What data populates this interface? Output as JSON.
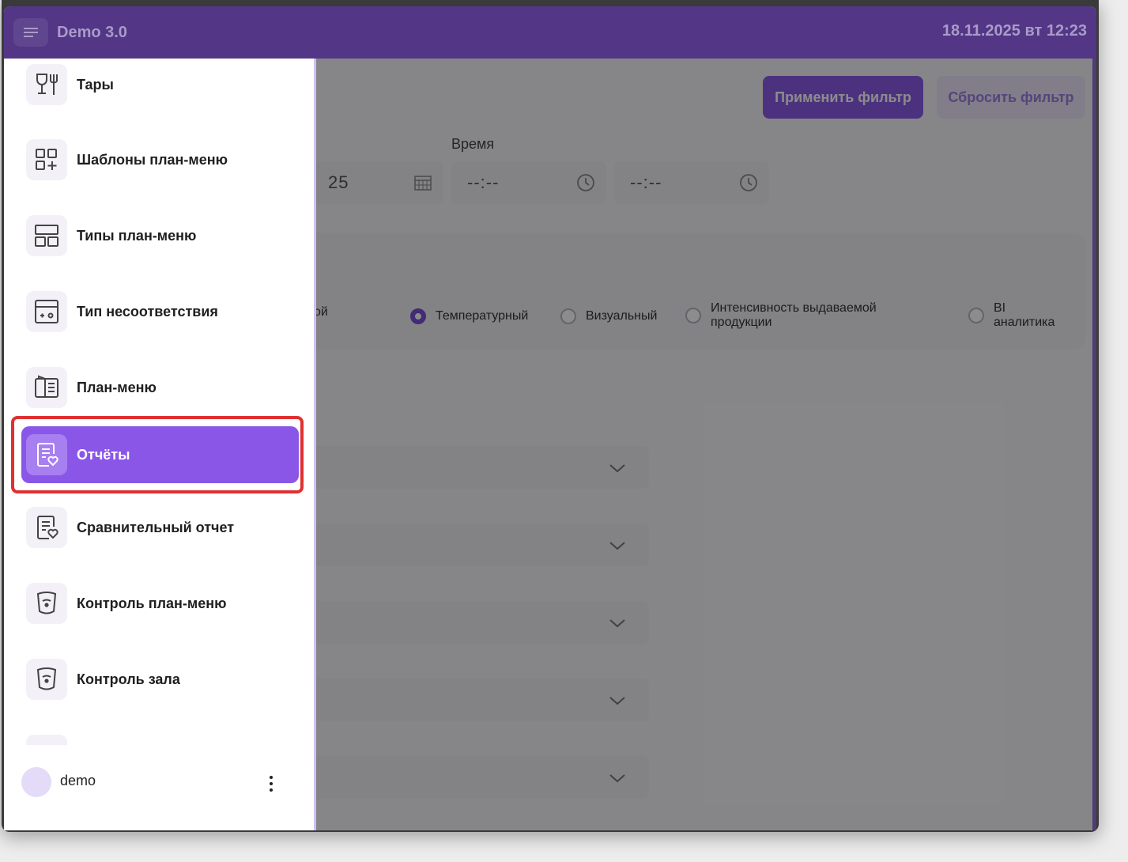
{
  "app": {
    "title": "Demo 3.0",
    "datetime": "18.11.2025 вт 12:23"
  },
  "filters": {
    "apply_label": "Применить фильтр",
    "reset_label": "Сбросить фильтр",
    "time_label": "Время",
    "date_value": "25",
    "time_from": "--:--",
    "time_to": "--:--"
  },
  "report_types": {
    "partial_label": "ой",
    "options": [
      {
        "label": "Температурный",
        "selected": true
      },
      {
        "label": "Визуальный",
        "selected": false
      },
      {
        "label": "Интенсивность выдаваемой продукции",
        "selected": false
      },
      {
        "label": "BI аналитика",
        "selected": false
      }
    ]
  },
  "sidebar": {
    "items": [
      {
        "label": "Тары",
        "icon": "glass-fork-icon",
        "active": false
      },
      {
        "label": "Шаблоны план-меню",
        "icon": "grid-plus-icon",
        "active": false
      },
      {
        "label": "Типы план-меню",
        "icon": "layout-grid-icon",
        "active": false
      },
      {
        "label": "Тип несоответствия",
        "icon": "panel-card-icon",
        "active": false
      },
      {
        "label": "План-меню",
        "icon": "open-book-icon",
        "active": false
      },
      {
        "label": "Отчёты",
        "icon": "report-heart-icon",
        "active": true
      },
      {
        "label": "Сравнительный отчет",
        "icon": "report-heart-icon",
        "active": false
      },
      {
        "label": "Контроль план-меню",
        "icon": "shield-icon",
        "active": false
      },
      {
        "label": "Контроль зала",
        "icon": "shield-icon",
        "active": false
      }
    ]
  },
  "user": {
    "name": "demo"
  },
  "colors": {
    "accent": "#8a56e8",
    "topbar": "#533686",
    "highlight": "#e03030"
  }
}
